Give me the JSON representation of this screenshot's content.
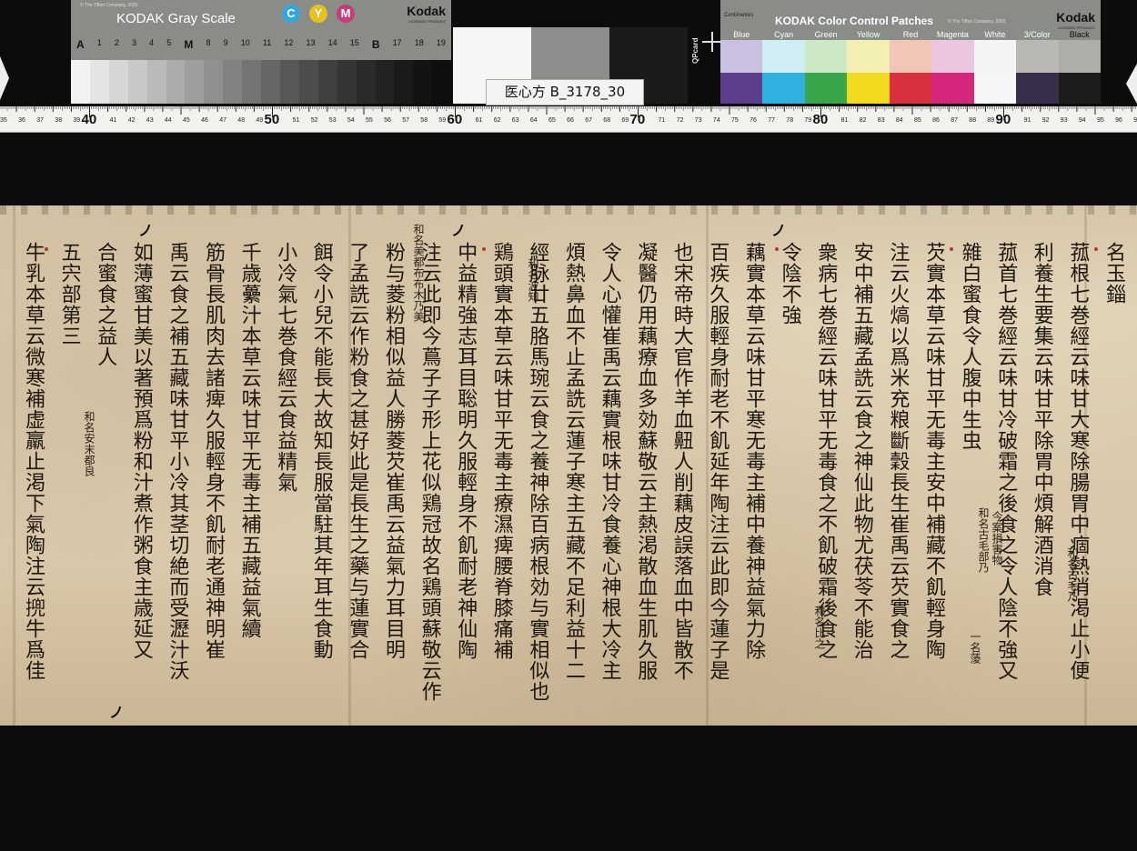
{
  "gray_card": {
    "tiffen": "© The Tiffen Company, 2000",
    "brand": "KODAK Gray Scale",
    "cym": [
      "C",
      "Y",
      "M"
    ],
    "kodak": "Kodak",
    "licensed": "LICENSED PRODUCT",
    "numbers": [
      "A",
      "1",
      "2",
      "3",
      "4",
      "5",
      "M",
      "8",
      "9",
      "10",
      "11",
      "12",
      "13",
      "14",
      "15",
      "B",
      "17",
      "18",
      "19"
    ]
  },
  "label": "医心方 B_3178_30",
  "qpcard": "QPcard",
  "color_card": {
    "centimetres": "Centimetres",
    "brand": "KODAK Color Control Patches",
    "tiffen": "© The Tiffen Company, 2000",
    "kodak": "Kodak",
    "licensed": "LICENSED PRODUCT",
    "labels": [
      "Blue",
      "Cyan",
      "Green",
      "Yellow",
      "Red",
      "Magenta",
      "White",
      "3/Color",
      "Black"
    ],
    "row1": [
      "#c9c0e2",
      "#d1eef4",
      "#cde8c5",
      "#f3efb2",
      "#f2c6b7",
      "#ecc6e0",
      "#f4f4f2",
      "#b9b8b4",
      "#adadaa"
    ],
    "row2": [
      "#5b3e8e",
      "#2fb1e0",
      "#3aa64c",
      "#f0d91f",
      "#d8303c",
      "#d6277d",
      "#f6f6f4",
      "#3a2f4a",
      "#1d1d1d"
    ]
  },
  "ruler": {
    "major": [
      "40",
      "50",
      "60",
      "70",
      "80",
      "90"
    ]
  },
  "manuscript": {
    "columns": [
      "名玉錙",
      "菰根七巻經云味甘大寒除腸胃中痼熱消渇止小便",
      "利養生要集云味甘平除胃中煩解酒消食",
      "菰首七巻經云味甘冷破霜之後食之令人陰不強又",
      "雜白蜜食令人腹中生虫",
      "芡實本草云味甘平无毒主安中補藏不飢輕身陶",
      "注云火熇以爲米充粮斷穀長生崔禹云芡實食之",
      "安中補五藏孟詵云食之神仙此物尤茯苓不能治",
      "衆病七巻經云味甘平无毒食之不飢破霜後食之",
      "令陰不強",
      "藕實本草云味甘平寒无毒主補中養神益氣力除",
      "百疾久服輕身耐老不飢延年陶注云此即今蓮子是",
      "也宋帝時大官作羊血䶊人削藕皮誤落血中皆散不",
      "凝醫仍用藕療血多効蘇敬云主熱渇散血生肌久服",
      "令人心懽崔禹云藕實根味甘冷食養心神根大冷主",
      "煩熱鼻血不止孟詵云蓮子寒主五藏不足利益十二",
      "經脉廿五胳馬琬云食之養神除百病根効与實相似也",
      "鶏頭實本草云味甘平无毒主療濕痺腰脊膝痛補",
      "中益精強志耳目聡明久服輕身不飢耐老神仙陶",
      "注云此即今蔦子子形上花似鶏冠故名鶏頭蘇敬云作",
      "粉与菱粉相似益人勝菱芡崔禹云益氣力耳目明",
      "了孟詵云作粉食之甚好此是長生之藥与蓮實合",
      "餌令小兒不能長大故知長服當駐其年耳生食動",
      "小冷氣七巻食經云食益精氣",
      "千歳虆汁本草云味甘平无毒主補五藏益氣續",
      "筋骨長肌肉去諸痺久服輕身不飢耐老通神明崔",
      "禹云食之補五藏味甘平小冷其茎切絶而受瀝汁沃",
      "如薄蜜甘美以著預爲粉和汁煮作粥食主歳延又",
      "合蜜食之益人",
      "五宍部第三",
      "牛乳本草云微寒補虚羸止渇下氣陶注云㨮牛爲佳"
    ],
    "annotations": [
      "和名古毛乃",
      "今案損害物",
      "和名古毛部乃",
      "一名蔆",
      "和名比之",
      "和名波知",
      "和名美都布布木乃美",
      "和名安末都良"
    ]
  }
}
